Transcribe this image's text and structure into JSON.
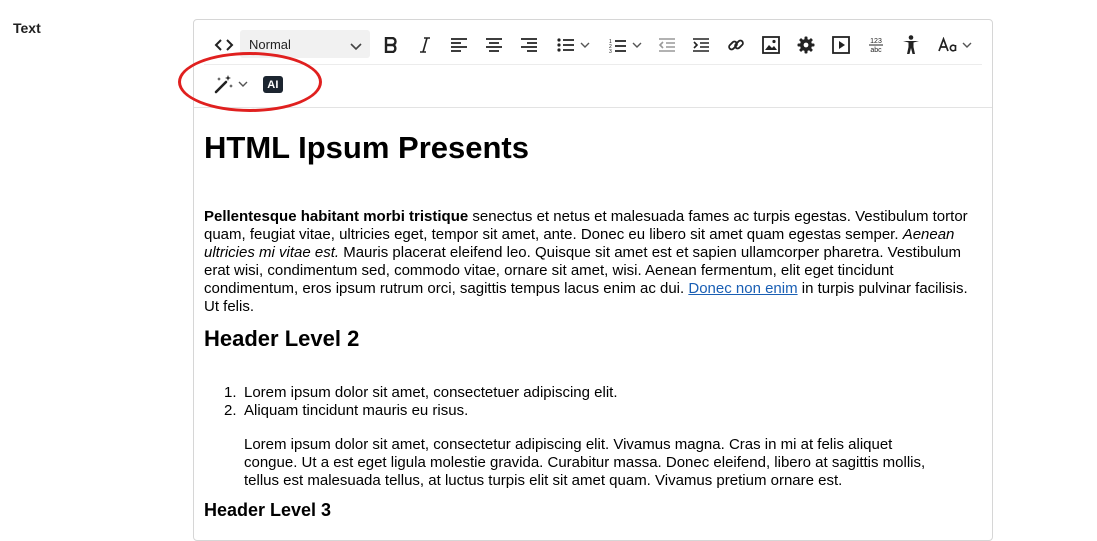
{
  "field": {
    "label": "Text"
  },
  "toolbar": {
    "style_value": "Normal",
    "ai_label": "AI",
    "icons": [
      "source-code",
      "bold",
      "italic",
      "align-left",
      "align-center",
      "align-right",
      "bullet-list",
      "numbered-list",
      "outdent",
      "indent",
      "link",
      "image",
      "gear",
      "video",
      "spellcheck",
      "accessibility",
      "font-size",
      "magic-wand",
      "ai"
    ],
    "spellcheck_text": "123 abc"
  },
  "annotation": {
    "color": "#e0201f"
  },
  "content": {
    "h1": "HTML Ipsum Presents",
    "intro": {
      "bold": "Pellentesque habitant morbi tristique",
      "t1": " senectus et netus et malesuada fames ac turpis egestas. Vestibulum tortor quam, feugiat vitae, ultricies eget, tempor sit amet, ante. Donec eu libero sit amet quam egestas semper. ",
      "italic": "Aenean ultricies mi vitae est.",
      "t2": " Mauris placerat eleifend leo. Quisque sit amet est et sapien ullamcorper pharetra. Vestibulum erat wisi, condimentum sed, commodo vitae, ornare sit amet, wisi. Aenean fermentum, elit eget tincidunt condimentum, eros ipsum rutrum orci, sagittis tempus lacus enim ac dui. ",
      "link": "Donec non enim",
      "t3": " in turpis pulvinar facilisis. Ut felis."
    },
    "h2": "Header Level 2",
    "list": [
      {
        "num": "1.",
        "text": "Lorem ipsum dolor sit amet, consectetuer adipiscing elit."
      },
      {
        "num": "2.",
        "text": "Aliquam tincidunt mauris eu risus."
      }
    ],
    "sub_paragraph": "Lorem ipsum dolor sit amet, consectetur adipiscing elit. Vivamus magna. Cras in mi at felis aliquet congue. Ut a est eget ligula molestie gravida. Curabitur massa. Donec eleifend, libero at sagittis mollis, tellus est malesuada tellus, at luctus turpis elit sit amet quam. Vivamus pretium ornare est.",
    "h3": "Header Level 3"
  }
}
